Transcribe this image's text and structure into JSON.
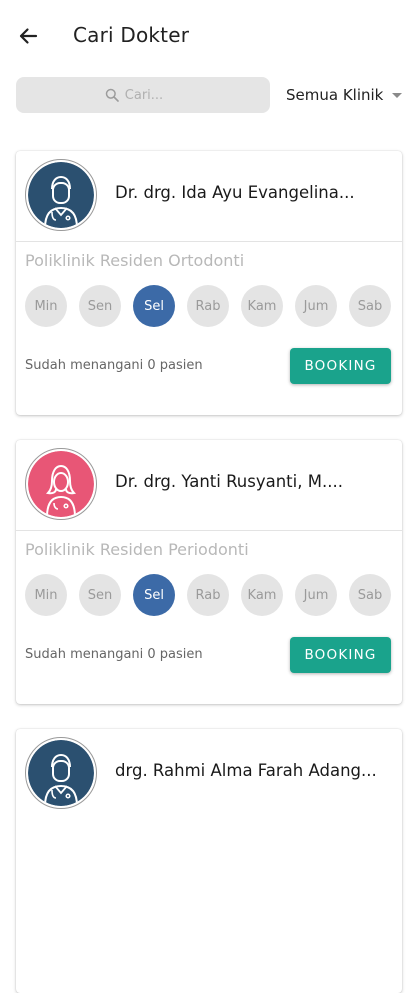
{
  "header": {
    "title": "Cari Dokter"
  },
  "search": {
    "placeholder": "Cari..."
  },
  "clinic_filter": {
    "selected": "Semua Klinik"
  },
  "day_labels": [
    "Min",
    "Sen",
    "Sel",
    "Rab",
    "Kam",
    "Jum",
    "Sab"
  ],
  "doctors": [
    {
      "name": "Dr. drg. Ida Ayu Evangelina...",
      "clinic": "Poliklinik Residen Ortodonti",
      "active_day": "Sel",
      "handled": "Sudah menangani 0 pasien",
      "booking_label": "BOOKING",
      "avatar": "male-doctor-icon",
      "avatar_color": "#2b5070"
    },
    {
      "name": "Dr. drg. Yanti Rusyanti, M....",
      "clinic": "Poliklinik Residen Periodonti",
      "active_day": "Sel",
      "handled": "Sudah menangani 0 pasien",
      "booking_label": "BOOKING",
      "avatar": "female-doctor-icon",
      "avatar_color": "#e85676"
    },
    {
      "name": "drg. Rahmi Alma Farah Adang...",
      "avatar": "male-doctor-icon",
      "avatar_color": "#2b5070"
    }
  ],
  "colors": {
    "active_day": "#3c6aa7",
    "booking_button": "#1aa38c",
    "search_bg": "#e5e5e5"
  }
}
